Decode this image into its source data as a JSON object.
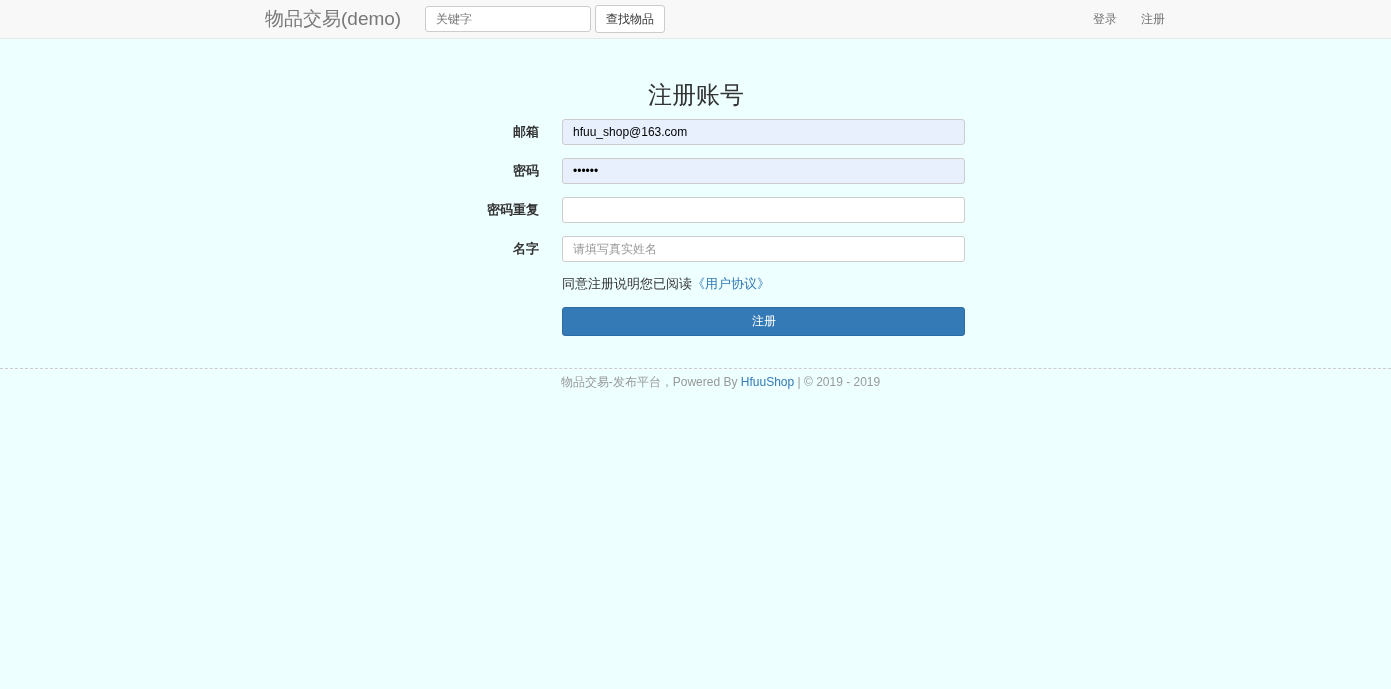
{
  "navbar": {
    "brand": "物品交易(demo)",
    "search": {
      "placeholder": "关键字"
    },
    "search_button": "查找物品",
    "links": [
      "登录",
      "注册"
    ]
  },
  "form": {
    "title": "注册账号",
    "fields": [
      {
        "label": "邮箱",
        "value": "hfuu_shop@163.com",
        "autofilled": true
      },
      {
        "label": "密码",
        "value": "••••••",
        "autofilled": true
      },
      {
        "label": "密码重复",
        "autofilled": false
      },
      {
        "label": "名字",
        "placeholder": "请填写真实姓名",
        "autofilled": false
      }
    ],
    "agreement": {
      "text": "同意注册说明您已阅读",
      "link": "《用户协议》"
    },
    "submit": "注册"
  },
  "footer": {
    "prefix": "物品交易-发布平台，Powered By ",
    "link": "HfuuShop",
    "suffix": " | © 2019 - 2019"
  }
}
